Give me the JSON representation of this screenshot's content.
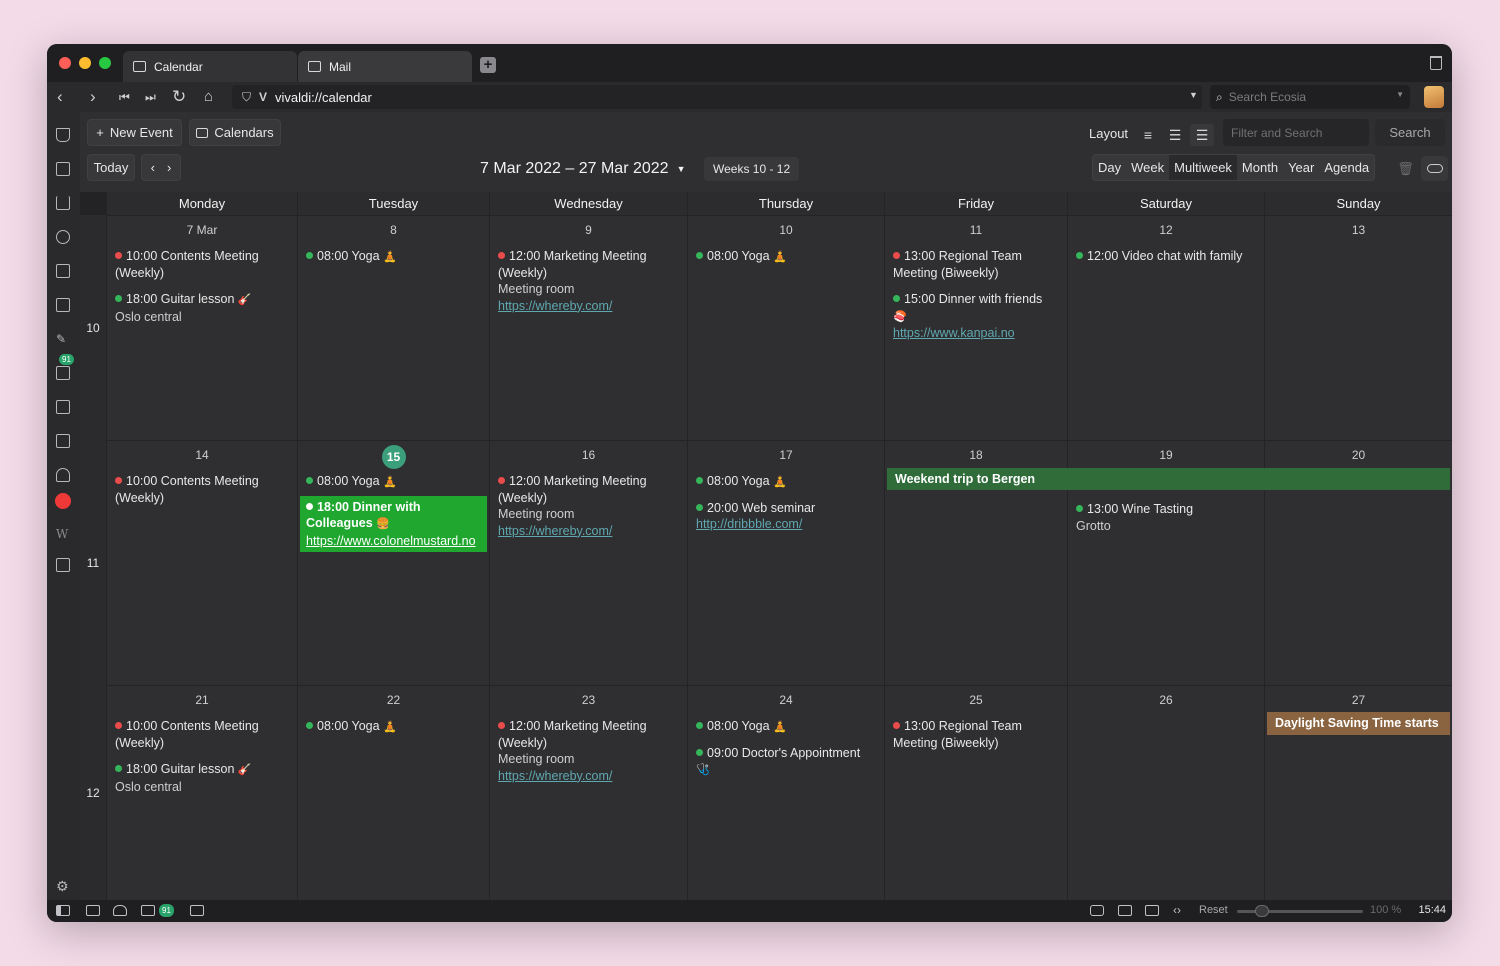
{
  "tabs": [
    {
      "label": "Calendar",
      "icon": "calendar-icon"
    },
    {
      "label": "Mail",
      "icon": "mail-icon"
    }
  ],
  "address": {
    "url": "vivaldi://calendar",
    "search_placeholder": "Search Ecosia"
  },
  "sidepanel": {
    "mail_badge": "91"
  },
  "toolbar": {
    "new_event": "New Event",
    "calendars": "Calendars",
    "layout_label": "Layout",
    "filter_placeholder": "Filter and Search",
    "search_button": "Search",
    "today": "Today",
    "date_range": "7 Mar 2022 – 27 Mar 2022",
    "weeks": "Weeks 10 - 12",
    "views": [
      "Day",
      "Week",
      "Multiweek",
      "Month",
      "Year",
      "Agenda"
    ],
    "active_view": "Multiweek"
  },
  "days": [
    "Monday",
    "Tuesday",
    "Wednesday",
    "Thursday",
    "Friday",
    "Saturday",
    "Sunday"
  ],
  "weeks": [
    {
      "number": "10",
      "dates": [
        "7 Mar",
        "8",
        "9",
        "10",
        "11",
        "12",
        "13"
      ],
      "events": [
        [
          {
            "dot": "red",
            "text": "10:00 Contents Meeting (Weekly)"
          },
          {
            "dot": "green",
            "text": "18:00 Guitar lesson",
            "emoji": "🎸",
            "sub": "Oslo central"
          }
        ],
        [
          {
            "dot": "green",
            "text": "08:00 Yoga",
            "emoji": "🧘"
          }
        ],
        [
          {
            "dot": "red",
            "text": "12:00 Marketing Meeting (Weekly)",
            "sub": "Meeting room",
            "link": "https://whereby.com/"
          }
        ],
        [
          {
            "dot": "green",
            "text": "08:00 Yoga",
            "emoji": "🧘"
          }
        ],
        [
          {
            "dot": "red",
            "text": "13:00 Regional Team Meeting (Biweekly)"
          },
          {
            "dot": "green",
            "text": "15:00 Dinner with friends",
            "emoji": "🍣",
            "link": "https://www.kanpai.no"
          }
        ],
        [
          {
            "dot": "green",
            "text": "12:00 Video chat with family"
          }
        ],
        []
      ]
    },
    {
      "number": "11",
      "dates": [
        "14",
        "15",
        "16",
        "17",
        "18",
        "19",
        "20"
      ],
      "today_index": 1,
      "allday": {
        "text": "Weekend trip to Bergen",
        "start": 4,
        "end": 6
      },
      "events": [
        [
          {
            "dot": "red",
            "text": "10:00 Contents Meeting (Weekly)"
          }
        ],
        [
          {
            "dot": "green",
            "text": "08:00 Yoga",
            "emoji": "🧘"
          },
          {
            "dot": "white",
            "text": "18:00 Dinner with Colleagues",
            "emoji": "🍔",
            "link": "https://www.colonelmustard.no",
            "highlight": true
          }
        ],
        [
          {
            "dot": "red",
            "text": "12:00 Marketing Meeting (Weekly)",
            "sub": "Meeting room",
            "link": "https://whereby.com/"
          }
        ],
        [
          {
            "dot": "green",
            "text": "08:00 Yoga",
            "emoji": "🧘"
          },
          {
            "dot": "green",
            "text": "20:00 Web seminar",
            "link": "http://dribbble.com/"
          }
        ],
        [],
        [
          {
            "dot": "green",
            "text": "13:00 Wine Tasting",
            "sub": "Grotto"
          }
        ],
        []
      ]
    },
    {
      "number": "12",
      "dates": [
        "21",
        "22",
        "23",
        "24",
        "25",
        "26",
        "27"
      ],
      "allday_single": {
        "text": "Daylight Saving Time starts",
        "day": 6
      },
      "events": [
        [
          {
            "dot": "red",
            "text": "10:00 Contents Meeting (Weekly)"
          },
          {
            "dot": "green",
            "text": "18:00 Guitar lesson",
            "emoji": "🎸",
            "sub": "Oslo central"
          }
        ],
        [
          {
            "dot": "green",
            "text": "08:00 Yoga",
            "emoji": "🧘"
          }
        ],
        [
          {
            "dot": "red",
            "text": "12:00 Marketing Meeting (Weekly)",
            "sub": "Meeting room",
            "link": "https://whereby.com/"
          }
        ],
        [
          {
            "dot": "green",
            "text": "08:00 Yoga",
            "emoji": "🧘"
          },
          {
            "dot": "green",
            "text": "09:00 Doctor's Appointment",
            "emoji": "🩺"
          }
        ],
        [
          {
            "dot": "red",
            "text": "13:00 Regional Team Meeting (Biweekly)"
          }
        ],
        [],
        []
      ]
    }
  ],
  "statusbar": {
    "mail_badge": "91",
    "reset": "Reset",
    "zoom": "100 %",
    "time": "15:44"
  },
  "colors": {
    "today": "#3b9f7c",
    "highlight_event": "#1fa72f",
    "allday_trip": "#2f6c3a",
    "allday_dst": "#8a6440",
    "red_dot": "#ea4c4c",
    "green_dot": "#36b65a"
  }
}
